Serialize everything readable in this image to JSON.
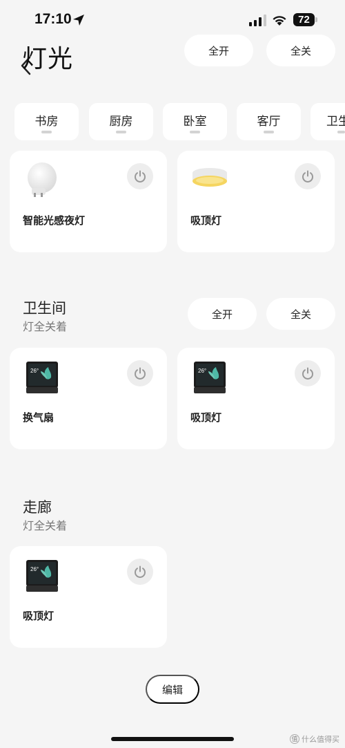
{
  "status_bar": {
    "time": "17:10",
    "battery": "72"
  },
  "header": {
    "title": "灯光",
    "all_on": "全开",
    "all_off": "全关"
  },
  "room_tabs": [
    {
      "label": "书房"
    },
    {
      "label": "厨房"
    },
    {
      "label": "卧室"
    },
    {
      "label": "客厅"
    },
    {
      "label": "卫生"
    }
  ],
  "sections": [
    {
      "devices": [
        {
          "name": "智能光感夜灯",
          "icon": "night-light-icon"
        },
        {
          "name": "吸顶灯",
          "icon": "ceiling-light-icon"
        }
      ]
    },
    {
      "title": "卫生间",
      "subtitle": "灯全关着",
      "all_on": "全开",
      "all_off": "全关",
      "devices": [
        {
          "name": "换气扇",
          "icon": "smart-display-icon",
          "screen_text": "26°"
        },
        {
          "name": "吸顶灯",
          "icon": "smart-display-icon",
          "screen_text": "26°"
        }
      ]
    },
    {
      "title": "走廊",
      "subtitle": "灯全关着",
      "devices": [
        {
          "name": "吸顶灯",
          "icon": "smart-display-icon",
          "screen_text": "26°"
        }
      ]
    }
  ],
  "edit_label": "编辑",
  "watermark": "什么值得买",
  "colors": {
    "background": "#f5f5f5",
    "card": "#ffffff",
    "power_button_bg": "#ededed",
    "ceiling_light_glow": "#f5d560"
  }
}
